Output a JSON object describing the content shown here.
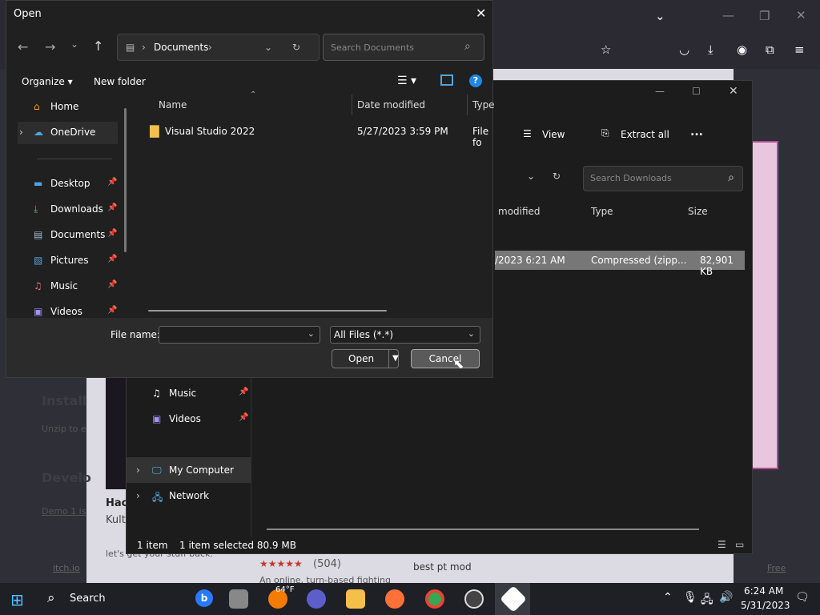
{
  "dialog": {
    "title": "Open",
    "address_crumb": "Documents",
    "search_placeholder": "Search Documents",
    "toolbar": {
      "organize": "Organize",
      "new_folder": "New folder"
    },
    "sidebar": [
      {
        "label": "Home",
        "icon": "home-icon",
        "pinned": false
      },
      {
        "label": "OneDrive",
        "icon": "cloud-icon",
        "pinned": false
      },
      {
        "label": "Desktop",
        "icon": "desktop-icon",
        "pinned": true
      },
      {
        "label": "Downloads",
        "icon": "download-icon",
        "pinned": true
      },
      {
        "label": "Documents",
        "icon": "document-icon",
        "pinned": true
      },
      {
        "label": "Pictures",
        "icon": "pictures-icon",
        "pinned": true
      },
      {
        "label": "Music",
        "icon": "music-icon",
        "pinned": true
      },
      {
        "label": "Videos",
        "icon": "videos-icon",
        "pinned": true
      }
    ],
    "columns": {
      "name": "Name",
      "date": "Date modified",
      "type": "Type"
    },
    "files": [
      {
        "name": "Visual Studio 2022",
        "date": "5/27/2023 3:59 PM",
        "type": "File fo"
      }
    ],
    "file_name_label": "File name:",
    "file_name_value": "",
    "filter": "All Files (*.*)",
    "open_label": "Open",
    "cancel_label": "Cancel"
  },
  "explorer": {
    "view_label": "View",
    "extract_label": "Extract all",
    "more_label": "...",
    "search_placeholder": "Search Downloads",
    "columns": {
      "modified": "modified",
      "type": "Type",
      "size": "Size"
    },
    "row": {
      "date": "/2023 6:21 AM",
      "type": "Compressed (zipp...",
      "size": "82,901 KB"
    },
    "sidebar": [
      {
        "label": "Music"
      },
      {
        "label": "Videos"
      },
      {
        "label": "My Computer"
      },
      {
        "label": "Network"
      }
    ],
    "status": {
      "count": "1 item",
      "selected": "1 item selected  80.9 MB"
    }
  },
  "webpage": {
    "heading1": "Install",
    "text1": "Unzip to e",
    "heading2": "Develo",
    "text2": "Demo 1 is",
    "card_title": "Hac",
    "card_sub": "Kult",
    "card_desc": "let's get your stuff back.",
    "rating_count": "(504)",
    "card2_desc": "An online, turn-based fighting",
    "best_pt": "best pt mod",
    "footer_link": "itch.io",
    "footer_right": "Free"
  },
  "taskbar": {
    "search": "Search",
    "weather": "64°F",
    "time": "6:24 AM",
    "date": "5/31/2023"
  }
}
